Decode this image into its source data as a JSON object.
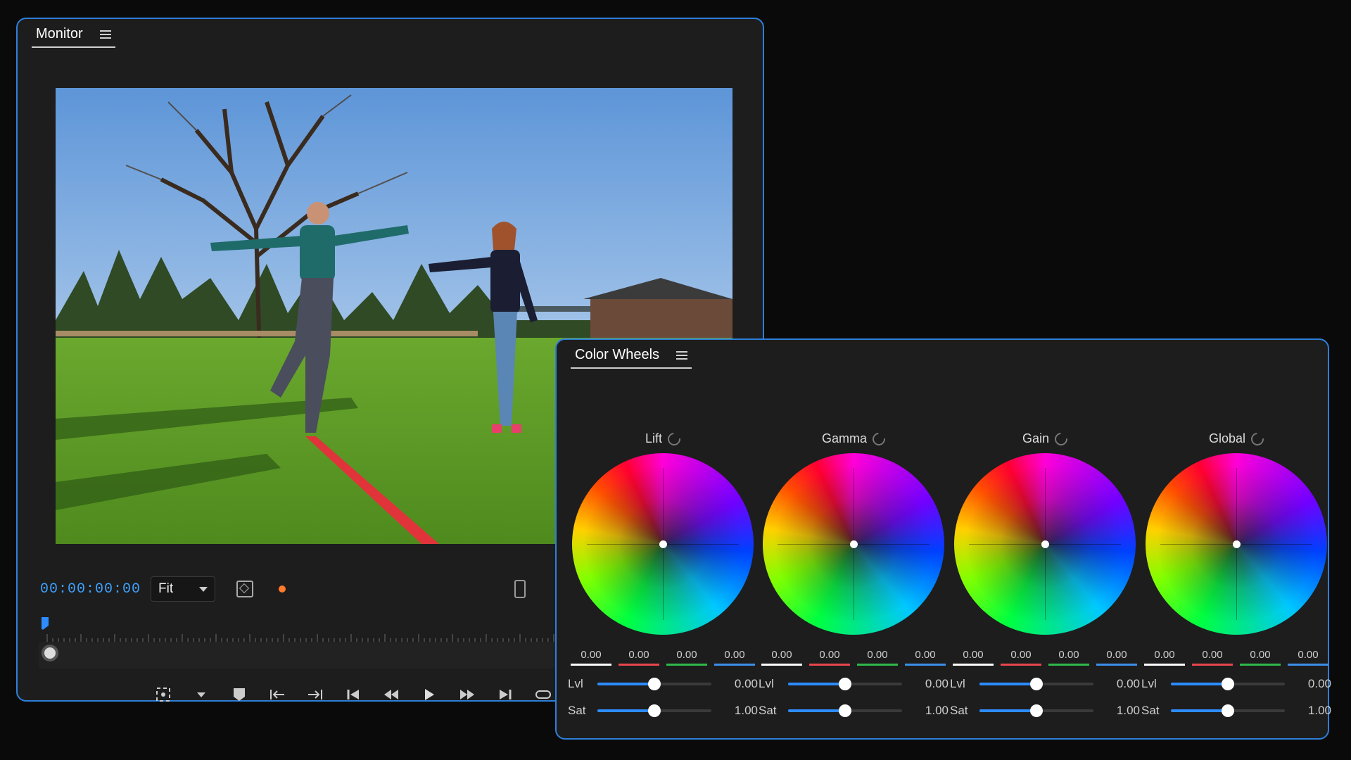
{
  "monitor": {
    "title": "Monitor",
    "timecode": "00:00:00:00",
    "zoom": "Fit",
    "playhead_fraction": 0.0
  },
  "color_wheels": {
    "title": "Color Wheels",
    "wheels": [
      {
        "name": "Lift",
        "values": [
          "0.00",
          "0.00",
          "0.00",
          "0.00"
        ],
        "lvl_label": "Lvl",
        "lvl": "0.00",
        "sat_label": "Sat",
        "sat": "1.00",
        "lvl_fraction": 0.5,
        "sat_fraction": 0.5
      },
      {
        "name": "Gamma",
        "values": [
          "0.00",
          "0.00",
          "0.00",
          "0.00"
        ],
        "lvl_label": "Lvl",
        "lvl": "0.00",
        "sat_label": "Sat",
        "sat": "1.00",
        "lvl_fraction": 0.5,
        "sat_fraction": 0.5
      },
      {
        "name": "Gain",
        "values": [
          "0.00",
          "0.00",
          "0.00",
          "0.00"
        ],
        "lvl_label": "Lvl",
        "lvl": "0.00",
        "sat_label": "Sat",
        "sat": "1.00",
        "lvl_fraction": 0.5,
        "sat_fraction": 0.5
      },
      {
        "name": "Global",
        "values": [
          "0.00",
          "0.00",
          "0.00",
          "0.00"
        ],
        "lvl_label": "Lvl",
        "lvl": "0.00",
        "sat_label": "Sat",
        "sat": "1.00",
        "lvl_fraction": 0.5,
        "sat_fraction": 0.5
      }
    ],
    "channel_colors": [
      "#ffffff",
      "#e8464b",
      "#2fb84a",
      "#3a8fe8"
    ]
  },
  "colors": {
    "accent": "#2d7fd9",
    "timecode": "#3ea0ff",
    "record_dot": "#ff7a2a"
  }
}
